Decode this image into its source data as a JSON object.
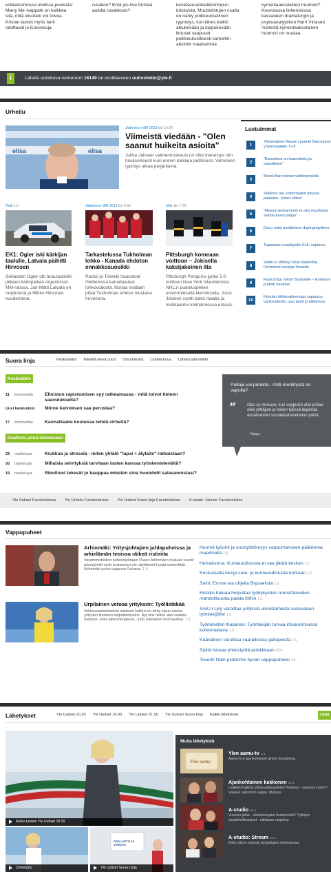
{
  "top_columns": [
    "kotikatsomossa idolinsa puolesta: Marry Me -kappale on kaikkea sitä, mitä viisufani voi toivoa. Kristan tavoin myös fanit odottavat jo Eurovisuja.",
    "rusakon? Entä jos itse törmää autolla rusakkoon?",
    "kevätseurantavikkonlopun tuloksista. Muuttolintujen osalta on nähty poikkeuksellinen ryynistys, kun lähes kaikki alkukevään ja loppukevään lintuset saapuvat poikkeuksellisesti samoihin aikoihin maahamme.",
    "kymenlaaksolainen huumori? Kouvolassa linkeroisissa kasvaneen dramaturgin ja psykoanalyytikon Harri Virtasen mielestä kymenlaaksolainen huumori on mustaa."
  ],
  "sms": {
    "icon": "i",
    "text_pre": "Lähetä uutiskuva numeroon ",
    "number": "16149",
    "text_mid": " tai osoitteeseen ",
    "email": "uutisvinkki@yle.fi"
  },
  "urheilu": {
    "title": "Urheilu",
    "lead": {
      "category": "Jääkiekon MM 2013",
      "time": "klo 10:09",
      "headline": "Viimeistä viedään - \"Olen saanut huikeita asioita\"",
      "text": "Jukka Jalosen valmennuskausi on ollut menestys niin tuloksellisesti kuin ennen kaikkea pelillisesti. Viimeinen rypistys alkaa perjantaina."
    },
    "stories": [
      {
        "category": "Ralli",
        "time": "1.5.",
        "headline": "EK1: Ogier iski kärkijan taululle, Latvala päihitti Hirvosen",
        "text": "Sebastien Ogier otti avauspäivän jälkeen kärkipaikan Argentiinan MM-ralissa. Jari-Matti Latvala on neljäntenä ja Mikko Hirvonen kuudentena."
      },
      {
        "category": "Jääkiekon MM 2013",
        "time": "klo 9:56",
        "headline": "Tarkastelussa Tukholman lohko - Kanada ehdoton ennakkosuosikki",
        "text": "Ruotsi ja Tshekki haastavat Globenissa kanadalaiset lohkovoitosta. Norjaa voidaan pitää Tukholman lohkon mustana hevosena."
      },
      {
        "category": "NHL",
        "time": "klo 7:32",
        "headline": "Pittsburgh komeaan voittoon – Jokisella kaksijakoinen ilta",
        "text": "Pittsburgh Penguins jyräsi 5-0 voittoon New York Islandersista NHL:n pudotuspelien ensimmäisellä kierroksella. Jussi Jokinen syötti kaksi maalia ja loukkaantui kolmannessa erässä."
      }
    ]
  },
  "luetuimmat": {
    "title": "Luetuimmat",
    "items": [
      {
        "num": "1",
        "text": "Ylivoimainen Bayern pudotti Barcelonan yhteismaalein 7–0!"
      },
      {
        "num": "2",
        "text": "\"Barcelona on haavoitettu ja vaarallinen\""
      },
      {
        "num": "3",
        "text": "Messi Barcelonan vaihtopenkillä"
      },
      {
        "num": "4",
        "text": "Selänne iski voittomaalin tutussa paikasta - katso video!"
      },
      {
        "num": "5",
        "text": "\"Messin pelaaminen ei olisi muuttanut asioita kovin paljon\""
      },
      {
        "num": "6",
        "text": "Deco antoi positiivisen dopingnäytteen"
      },
      {
        "num": "7",
        "text": "Tappaiaan maalitykille KHL-sopimus"
      },
      {
        "num": "8",
        "text": "Voitto ei riittänyt Real Madridille, Dortmund selviytyi finaaliin"
      },
      {
        "num": "9",
        "text": "Rasit torjui voiton Bostonille – Komarov pudotti hanskat"
      },
      {
        "num": "10",
        "text": "Kohuttu hiihtovalmentaja vapautuu vankeudesta, uusi pesti jo kiikarissa"
      }
    ]
  },
  "suora_linja": {
    "title": "Suora linja",
    "tabs": [
      "Keskustelut",
      "Tekeillä olevat jutut",
      "Ota yhteyttä",
      "Lähetä kuva",
      "Lähetä juttuvinkki"
    ],
    "keskustele_label": "Keskustele",
    "discussions": [
      {
        "n": "11",
        "kind": "kommenttia",
        "q": "Eliniston rapistumisen syy ratkeamassa - mitä toivot tieteen saavutukselta?"
      },
      {
        "n": "Uusi keskustelu",
        "kind": "",
        "q": "Minne kaivoksen saa perustaa?"
      },
      {
        "n": "17",
        "kind": "kommenttia",
        "q": "Kannattaako koulussa tehdä virheitä?"
      }
    ],
    "osallistu_label": "Osallistu jutun tekemiseen",
    "polls": [
      {
        "n": "25",
        "kind": "osallistujaa",
        "q": "Kiukkua ja stressiä - miten yhtälö \"lapsi + älylaite\" ratkaistaan?"
      },
      {
        "n": "20",
        "kind": "osallistujaa",
        "q": "Millaisia selvityksiä tarvitaan lasten kanssa työskentelevältä?"
      },
      {
        "n": "19",
        "kind": "osallistujaa",
        "q": "Rikolliset tekevät jo kauppaa miesten sina huolehdit salasanoistasi?"
      }
    ],
    "quote": {
      "title": "Palloja vai puheita - mitä merkitystä on vapulla?",
      "text": "Olisi se mukava, kun vappukin olisi juhlaa eikä yrittäjien ja toisen työssä leipänsä ansaitsevien vastakkainasettelun päivä.",
      "author": "- Vappu"
    },
    "fb_links": [
      "Yle Uutiset Facebookissa",
      "Yle Urheilu Facebookissa",
      "Yle Uutiset Suora linja Facebookissa",
      "A-studio: Stream Facebookissa"
    ]
  },
  "vappupuheet": {
    "title": "Vappupuheet",
    "stories": [
      {
        "headline": "Arhinmäki: Yritysjohtajien juhlapuheissa ja arkielämän teoissa räikeä ristiriita",
        "text": "Vasemmistoliiton puheenjohtajan Paavo Arhinmäen mukaan suurel pörssiyhtiöt eivät toistaiseksi ole näyttäneet hyvää esimerkkiä. Arhinmäki puhui vappuna Oulussa.",
        "date": "1.5."
      },
      {
        "headline": "Urpilainen vetoaa yrityksiin: Työllistäkää",
        "text": "Valtiovarainministerin mielestä hallitus on tehty tukun asioita yritysten tilanteen helpottamiseksi. Nyt olisi niiden aika vastata huutoon, edes talkoohengessä, Jutta Urpilainen huomauttaa.",
        "date": "1.5."
      }
    ],
    "list": [
      {
        "text": "Huonot työolot ja suurtyöttömyys vappumarssien pääteema maailmalla",
        "date": "1.5."
      },
      {
        "text": "Heinäluoma: Kuntauudistusta ei saa jättää kesken",
        "date": "1.5."
      },
      {
        "text": "Keskustalta iskuja sote- ja kuntauudistusta kohtaan",
        "date": "1.5."
      },
      {
        "text": "Soini: Emme ota ohjeita Brysselistä",
        "date": "1.5."
      },
      {
        "text": "Risikko haluaa helpottaa työkykyisten menettäneiden mahdollisuutta palata töihin",
        "date": "1.5."
      },
      {
        "text": "SAK:n Lyly varoittaa yrityksiä ulkoistamasta vastuutaan työntekijöille",
        "date": "1.5."
      },
      {
        "text": "Työministeri Ihalainen: Työntekijän turvaa irtisanomisissa kohennettava",
        "date": "1.5."
      },
      {
        "text": "Kääriäinen varoittaa vaarallisista gallupeista",
        "date": "1.5."
      },
      {
        "text": "Sipilä haluaa yhteistyötä politiikkaan",
        "date": "30.4."
      },
      {
        "text": "Toverit! Näin pidämme hyvän vappupuheen",
        "date": "1.5."
      }
    ]
  },
  "lahetykset": {
    "title": "Lähetykset",
    "tabs": [
      "Yle Uutiset 20.30",
      "Yle Uutiset 18.00",
      "Yle Uutiset 21.50",
      "Yle Uutiset Suora linja",
      "Kaikki lähetykset"
    ],
    "more_button": "Lisää",
    "main_caption": "Katso tuorein Yle Uutiset 20:30",
    "bottom_caption_1": "Urheiluutu",
    "bottom_caption_2": "Yle Uutiset Suora Linja",
    "thumb_overlay": "OSALLISTU JA VAIKUTA",
    "muut_title": "Muita lähetyksiä",
    "muut": [
      {
        "title": "Ylen aamu-tv",
        "date": "1.5.",
        "text": "Aamu-tv:n ajankohtaiset aiheet koosteena."
      },
      {
        "title": "Ajankohtainen kakkonen",
        "date": "30.4.",
        "text": "Leikkikö hallitus ydintuvallisuudella? Fellman - sovinnon pelto? Vaasan valkoinen vappu. Malissa"
      },
      {
        "title": "A-studio",
        "date": "25.4.",
        "text": "Vussien piina - vääriinkorjatut homekoulut? Tyttöjen ympärileikkaukset - miltaisen ongelma"
      },
      {
        "title": "A-studio: Stream",
        "date": "26.4.",
        "text": "Koko viikon netissä, perjantaisin televisiossa."
      }
    ]
  }
}
